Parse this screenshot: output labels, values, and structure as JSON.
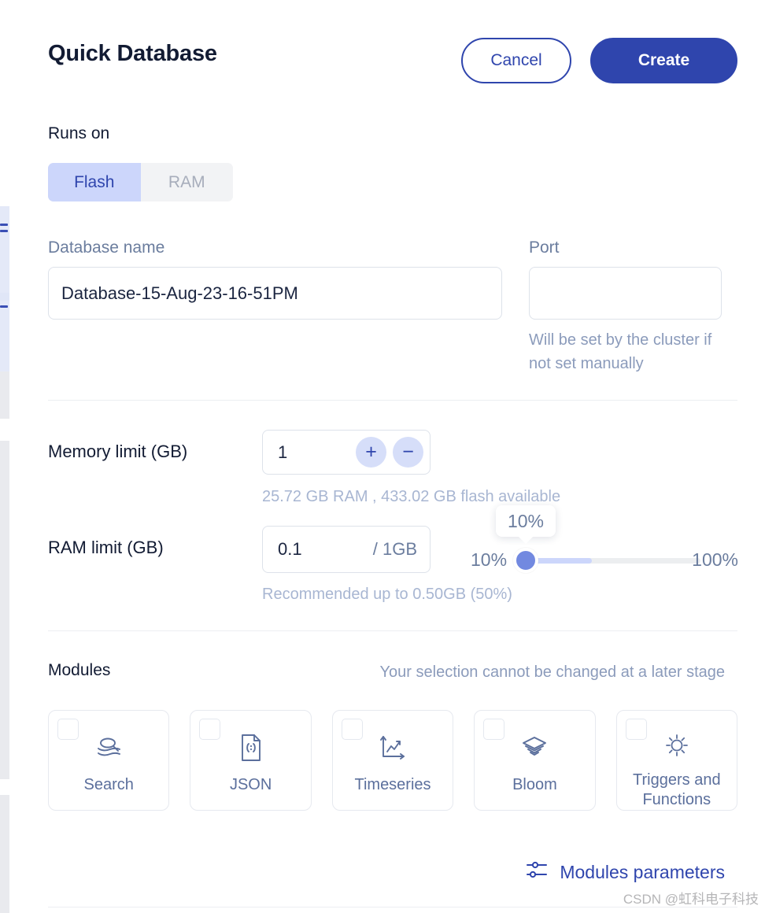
{
  "header": {
    "title": "Quick Database",
    "cancel_label": "Cancel",
    "create_label": "Create"
  },
  "runs_on": {
    "label": "Runs on",
    "options": [
      "Flash",
      "RAM"
    ],
    "selected": "Flash"
  },
  "database_name": {
    "label": "Database name",
    "value": "Database-15-Aug-23-16-51PM",
    "placeholder": ""
  },
  "port": {
    "label": "Port",
    "value": "",
    "placeholder": "",
    "hint": "Will be set by the cluster if not set manually"
  },
  "memory_limit": {
    "label": "Memory limit (GB)",
    "value": "1",
    "increase_label": "+",
    "decrease_label": "−",
    "help": "25.72 GB RAM , 433.02 GB flash available"
  },
  "ram_limit": {
    "label": "RAM limit (GB)",
    "value": "0.1",
    "max_suffix": "/ 1GB",
    "help": "Recommended up to 0.50GB (50%)"
  },
  "slider": {
    "min_label": "10%",
    "max_label": "100%",
    "tooltip": "10%",
    "value_percent": 10
  },
  "modules": {
    "label": "Modules",
    "note": "Your selection cannot be changed at a later stage",
    "items": [
      {
        "label": "Search",
        "icon": "search-layers-icon",
        "checked": false
      },
      {
        "label": "JSON",
        "icon": "json-document-icon",
        "checked": false
      },
      {
        "label": "Timeseries",
        "icon": "timeseries-chart-icon",
        "checked": false
      },
      {
        "label": "Bloom",
        "icon": "bloom-layers-icon",
        "checked": false
      },
      {
        "label": "Triggers and Functions",
        "icon": "gear-icon",
        "checked": false
      }
    ]
  },
  "modules_parameters": {
    "label": "Modules parameters",
    "icon": "sliders-icon"
  },
  "watermark": "CSDN @虹科电子科技",
  "colors": {
    "primary": "#2f45ad",
    "accent_light": "#ccd6fb",
    "muted_text": "#8b9bbb",
    "title_text": "#121b33"
  }
}
